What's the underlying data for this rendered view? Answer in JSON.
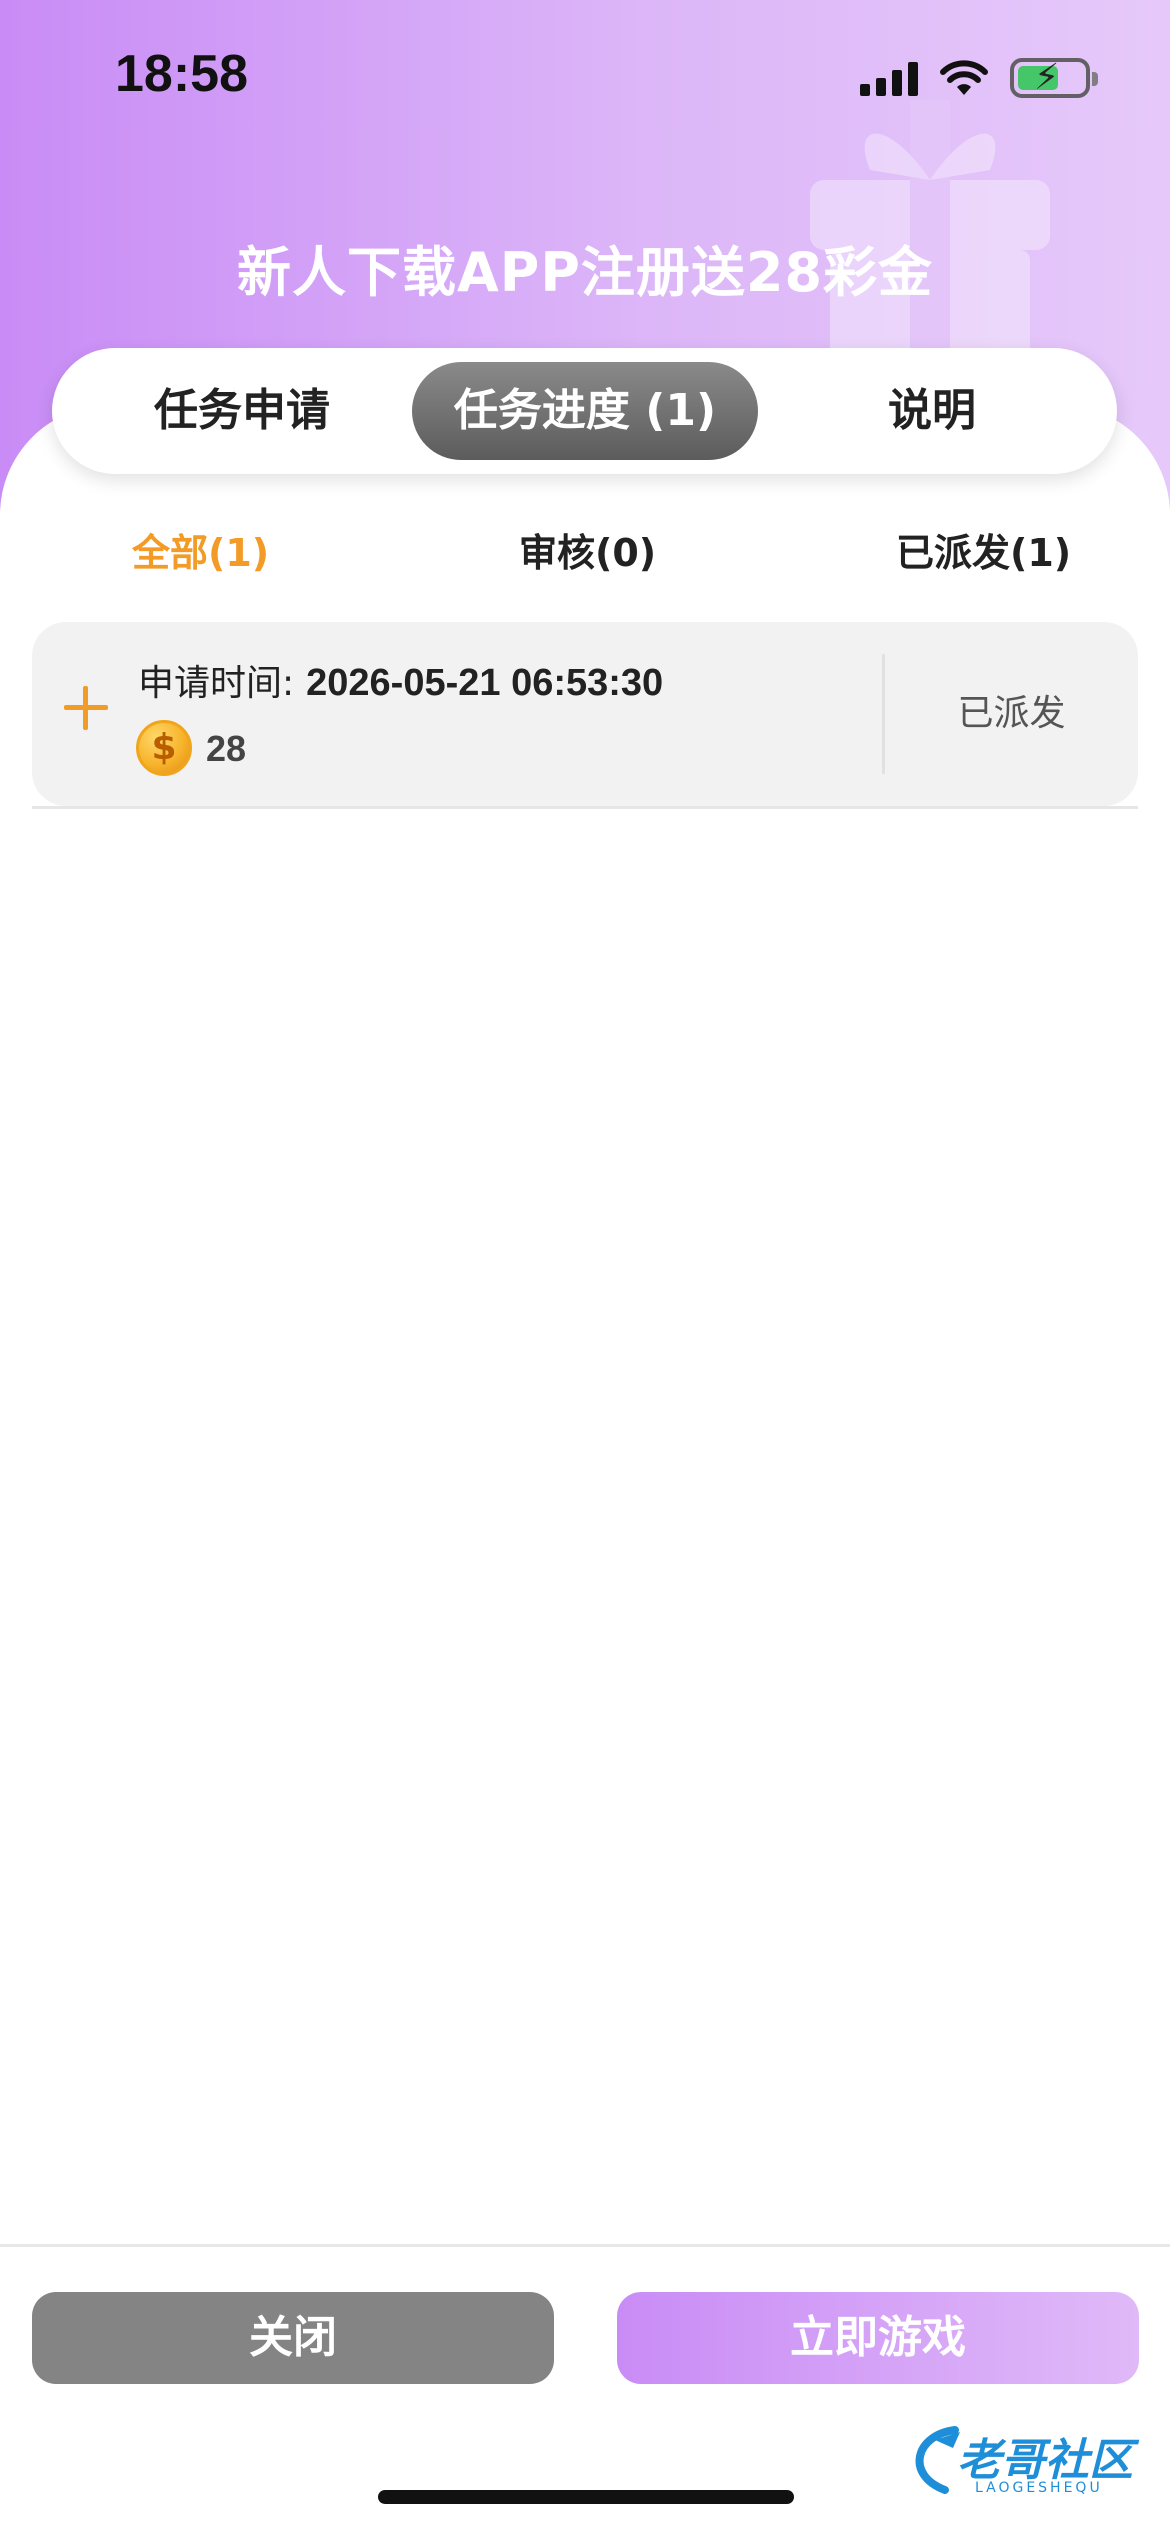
{
  "status_bar": {
    "time": "18:58",
    "icons": [
      "signal-icon",
      "wifi-icon",
      "battery-charging-icon"
    ]
  },
  "header": {
    "title": "新人下载APP注册送28彩金"
  },
  "main_tabs": [
    {
      "label": "任务申请",
      "active": false
    },
    {
      "label": "任务进度 (1)",
      "active": true
    },
    {
      "label": "说明",
      "active": false
    }
  ],
  "sub_tabs": [
    {
      "label": "全部(1)",
      "active": true
    },
    {
      "label": "审核(0)",
      "active": false
    },
    {
      "label": "已派发(1)",
      "active": false
    }
  ],
  "records": [
    {
      "apply_time_label": "申请时间:",
      "apply_time_value": "2026-05-21 06:53:30",
      "amount": "28",
      "status": "已派发"
    }
  ],
  "buttons": {
    "close": "关闭",
    "play": "立即游戏"
  },
  "watermark": {
    "text": "老哥社区",
    "subtext": "LAOGESHEQU"
  },
  "colors": {
    "header_gradient_start": "#c98cf6",
    "header_gradient_end": "#e6c9fa",
    "accent_orange": "#f29b26",
    "active_tab_gray": "#6e6e6e",
    "close_button": "#848484",
    "watermark_blue": "#1f8ed8"
  }
}
